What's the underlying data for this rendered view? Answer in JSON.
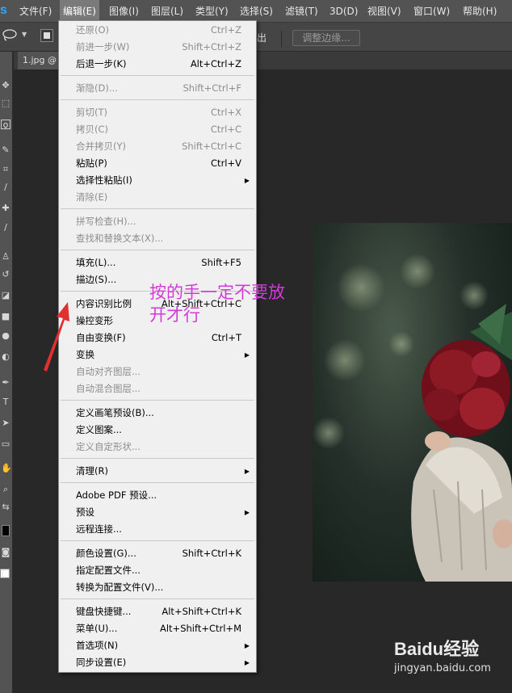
{
  "menubar": {
    "app_letter": "s",
    "items": [
      {
        "label": "文件(F)"
      },
      {
        "label": "编辑(E)"
      },
      {
        "label": "图像(I)"
      },
      {
        "label": "图层(L)"
      },
      {
        "label": "类型(Y)"
      },
      {
        "label": "选择(S)"
      },
      {
        "label": "滤镜(T)"
      },
      {
        "label": "3D(D)"
      },
      {
        "label": "视图(V)"
      },
      {
        "label": "窗口(W)"
      },
      {
        "label": "帮助(H)"
      }
    ]
  },
  "options_bar": {
    "partial_label": "出",
    "adjust_edge_button": "调整边缘..."
  },
  "document": {
    "tab_label": "1.jpg @"
  },
  "edit_menu": {
    "items": [
      {
        "label": "还原(O)",
        "shortcut": "Ctrl+Z",
        "disabled": true
      },
      {
        "label": "前进一步(W)",
        "shortcut": "Shift+Ctrl+Z",
        "disabled": true
      },
      {
        "label": "后退一步(K)",
        "shortcut": "Alt+Ctrl+Z",
        "disabled": false
      },
      {
        "label": "渐隐(D)...",
        "shortcut": "Shift+Ctrl+F",
        "disabled": true
      },
      {
        "label": "剪切(T)",
        "shortcut": "Ctrl+X",
        "disabled": true
      },
      {
        "label": "拷贝(C)",
        "shortcut": "Ctrl+C",
        "disabled": true
      },
      {
        "label": "合并拷贝(Y)",
        "shortcut": "Shift+Ctrl+C",
        "disabled": true
      },
      {
        "label": "粘贴(P)",
        "shortcut": "Ctrl+V",
        "disabled": false
      },
      {
        "label": "选择性粘贴(I)",
        "shortcut": "",
        "disabled": false,
        "submenu": true
      },
      {
        "label": "清除(E)",
        "shortcut": "",
        "disabled": true
      },
      {
        "label": "拼写检查(H)...",
        "shortcut": "",
        "disabled": true
      },
      {
        "label": "查找和替换文本(X)...",
        "shortcut": "",
        "disabled": true
      },
      {
        "label": "填充(L)...",
        "shortcut": "Shift+F5",
        "disabled": false
      },
      {
        "label": "描边(S)...",
        "shortcut": "",
        "disabled": false
      },
      {
        "label": "内容识别比例",
        "shortcut": "Alt+Shift+Ctrl+C",
        "disabled": false
      },
      {
        "label": "操控变形",
        "shortcut": "",
        "disabled": false
      },
      {
        "label": "自由变换(F)",
        "shortcut": "Ctrl+T",
        "disabled": false
      },
      {
        "label": "变换",
        "shortcut": "",
        "disabled": false,
        "submenu": true
      },
      {
        "label": "自动对齐图层...",
        "shortcut": "",
        "disabled": true
      },
      {
        "label": "自动混合图层...",
        "shortcut": "",
        "disabled": true
      },
      {
        "label": "定义画笔预设(B)...",
        "shortcut": "",
        "disabled": false
      },
      {
        "label": "定义图案...",
        "shortcut": "",
        "disabled": false
      },
      {
        "label": "定义自定形状...",
        "shortcut": "",
        "disabled": true
      },
      {
        "label": "清理(R)",
        "shortcut": "",
        "disabled": false,
        "submenu": true
      },
      {
        "label": "Adobe PDF 预设...",
        "shortcut": "",
        "disabled": false
      },
      {
        "label": "预设",
        "shortcut": "",
        "disabled": false,
        "submenu": true
      },
      {
        "label": "远程连接...",
        "shortcut": "",
        "disabled": false
      },
      {
        "label": "颜色设置(G)...",
        "shortcut": "Shift+Ctrl+K",
        "disabled": false
      },
      {
        "label": "指定配置文件...",
        "shortcut": "",
        "disabled": false
      },
      {
        "label": "转换为配置文件(V)...",
        "shortcut": "",
        "disabled": false
      },
      {
        "label": "键盘快捷键...",
        "shortcut": "Alt+Shift+Ctrl+K",
        "disabled": false
      },
      {
        "label": "菜单(U)...",
        "shortcut": "Alt+Shift+Ctrl+M",
        "disabled": false
      },
      {
        "label": "首选项(N)",
        "shortcut": "",
        "disabled": false,
        "submenu": true
      },
      {
        "label": "同步设置(E)",
        "shortcut": "",
        "disabled": false,
        "submenu": true
      }
    ]
  },
  "annotation": {
    "line1": "按的手一定不要放",
    "line2": "开才行",
    "color": "#d23bd8"
  },
  "watermark": {
    "logo": "Baidu经验",
    "url": "jingyan.baidu.com"
  },
  "colors": {
    "menubar_bg": "#535353",
    "menu_bg": "#f0f0f0",
    "disabled_text": "#8d8d8d",
    "arrow": "#e03030"
  }
}
